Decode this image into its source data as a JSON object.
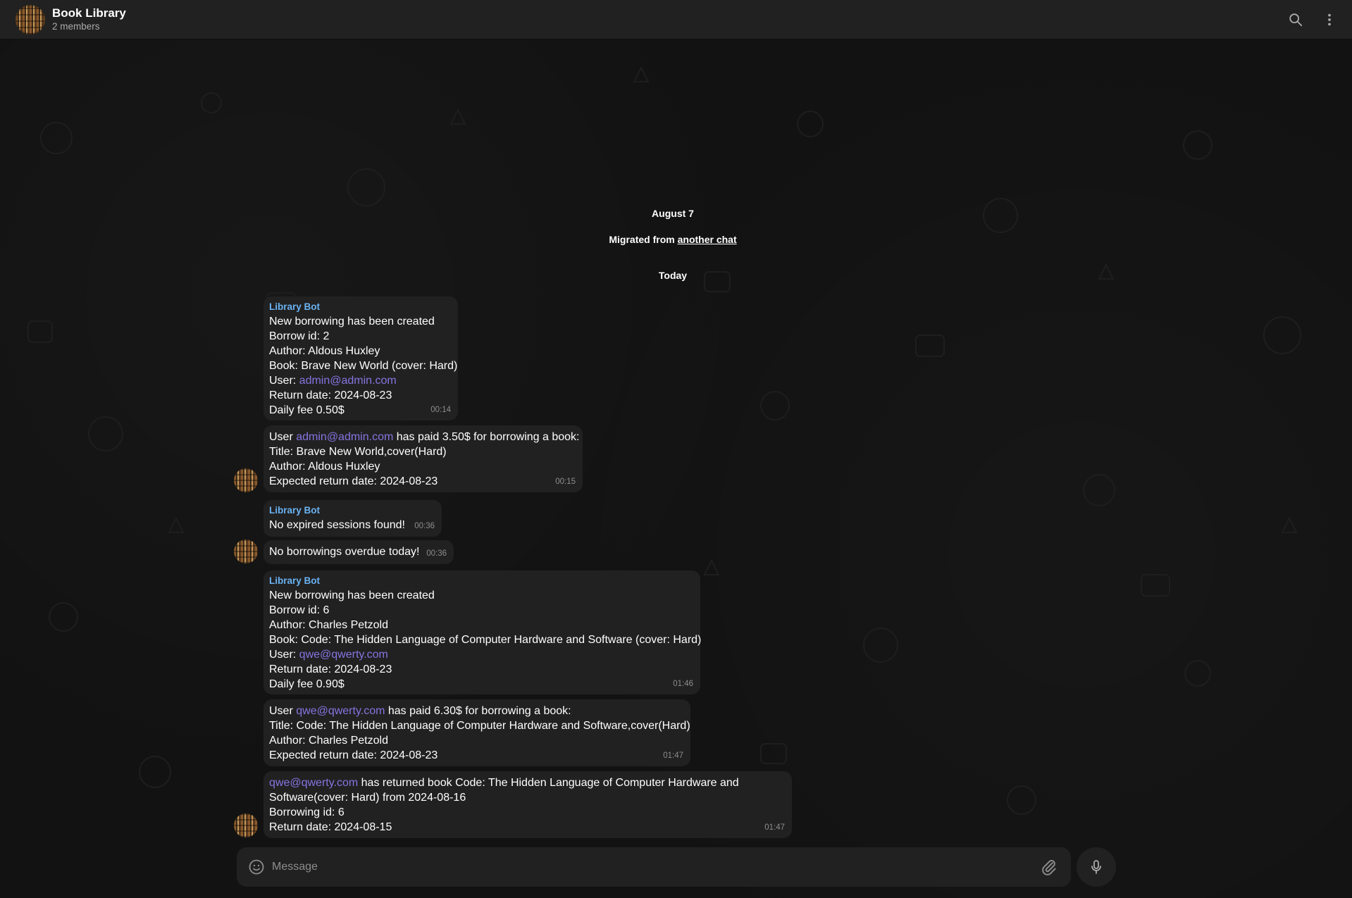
{
  "header": {
    "title": "Book Library",
    "subtitle": "2 members"
  },
  "service": {
    "date1": "August 7",
    "migrated_prefix": "Migrated from ",
    "migrated_link": "another chat",
    "date2": "Today"
  },
  "messages": [
    {
      "sender": "Library Bot",
      "lines": [
        "New borrowing has been created",
        "Borrow id: 2",
        "Author: Aldous Huxley",
        "Book: Brave New World (cover: Hard)"
      ],
      "user_prefix": "User: ",
      "user_link": "admin@admin.com",
      "tail": [
        "Return date: 2024-08-23",
        "Daily fee 0.50$"
      ],
      "time": "00:14"
    },
    {
      "pay_prefix": "User ",
      "pay_link": "admin@admin.com",
      "pay_suffix": " has paid 3.50$ for borrowing a book:",
      "lines": [
        "Title: Brave New World,cover(Hard)",
        "Author: Aldous Huxley",
        "Expected return date: 2024-08-23"
      ],
      "time": "00:15"
    },
    {
      "sender": "Library Bot",
      "text": "No expired sessions found!",
      "time": "00:36"
    },
    {
      "text": "No borrowings overdue today!",
      "time": "00:36"
    },
    {
      "sender": "Library Bot",
      "lines": [
        "New borrowing has been created",
        "Borrow id: 6",
        "Author: Charles Petzold",
        "Book: Code: The Hidden Language of Computer Hardware and Software (cover: Hard)"
      ],
      "user_prefix": "User: ",
      "user_link": "qwe@qwerty.com",
      "tail": [
        "Return date: 2024-08-23",
        "Daily fee 0.90$"
      ],
      "time": "01:46"
    },
    {
      "pay_prefix": "User ",
      "pay_link": "qwe@qwerty.com",
      "pay_suffix": " has paid 6.30$ for borrowing a book:",
      "lines": [
        "Title: Code: The Hidden Language of Computer Hardware and Software,cover(Hard)",
        "Author: Charles Petzold",
        "Expected return date: 2024-08-23"
      ],
      "time": "01:47"
    },
    {
      "ret_link": "qwe@qwerty.com",
      "ret_suffix": " has returned book Code: The Hidden Language of Computer Hardware and",
      "lines": [
        "Software(cover: Hard) from 2024-08-16",
        "Borrowing id: 6",
        "Return date: 2024-08-15"
      ],
      "time": "01:47"
    }
  ],
  "composer": {
    "placeholder": "Message"
  },
  "icons": {
    "search": "search-icon",
    "more": "more-vertical-icon",
    "emoji": "emoji-icon",
    "attach": "paperclip-icon",
    "mic": "microphone-icon"
  }
}
